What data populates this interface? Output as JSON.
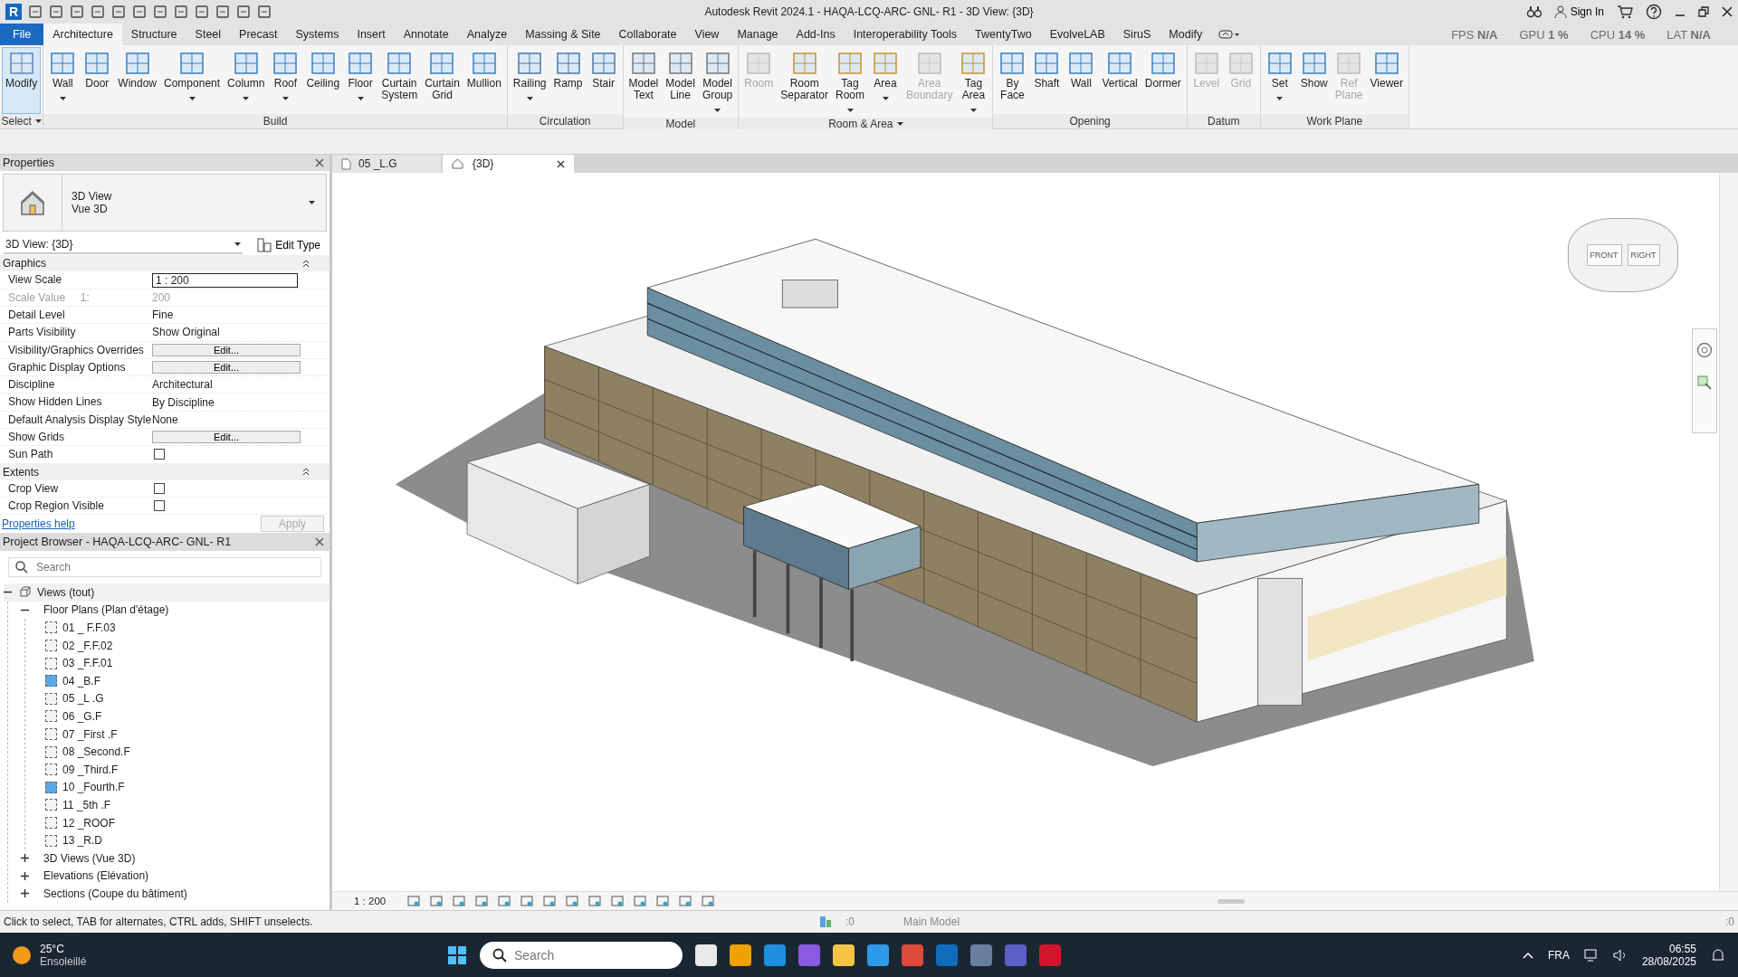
{
  "window": {
    "app_logo": "R",
    "title": "Autodesk Revit 2024.1 - HAQA-LCQ-ARC- GNL- R1 - 3D View: {3D}",
    "sign_in": "Sign In"
  },
  "perf_overlay": [
    {
      "label": "FPS",
      "value": "N/A"
    },
    {
      "label": "GPU",
      "value": "1 %"
    },
    {
      "label": "CPU",
      "value": "14 %"
    },
    {
      "label": "LAT",
      "value": "N/A"
    }
  ],
  "ribbon_tabs": [
    {
      "label": "File",
      "kind": "file",
      "selected": false
    },
    {
      "label": "Architecture",
      "kind": "tab",
      "selected": true
    },
    {
      "label": "Structure",
      "kind": "tab",
      "selected": false
    },
    {
      "label": "Steel",
      "kind": "tab",
      "selected": false
    },
    {
      "label": "Precast",
      "kind": "tab",
      "selected": false
    },
    {
      "label": "Systems",
      "kind": "tab",
      "selected": false
    },
    {
      "label": "Insert",
      "kind": "tab",
      "selected": false
    },
    {
      "label": "Annotate",
      "kind": "tab",
      "selected": false
    },
    {
      "label": "Analyze",
      "kind": "tab",
      "selected": false
    },
    {
      "label": "Massing & Site",
      "kind": "tab",
      "selected": false
    },
    {
      "label": "Collaborate",
      "kind": "tab",
      "selected": false
    },
    {
      "label": "View",
      "kind": "tab",
      "selected": false
    },
    {
      "label": "Manage",
      "kind": "tab",
      "selected": false
    },
    {
      "label": "Add-Ins",
      "kind": "tab",
      "selected": false
    },
    {
      "label": "Interoperability Tools",
      "kind": "tab",
      "selected": false
    },
    {
      "label": "TwentyTwo",
      "kind": "tab",
      "selected": false
    },
    {
      "label": "EvolveLAB",
      "kind": "tab",
      "selected": false
    },
    {
      "label": "SiruS",
      "kind": "tab",
      "selected": false
    },
    {
      "label": "Modify",
      "kind": "tab",
      "selected": false
    }
  ],
  "ribbon_panels": [
    {
      "label": "Select",
      "dropdown": true,
      "tools": [
        {
          "label": "Modify",
          "selected": true,
          "disabled": false,
          "dropdown": false
        }
      ]
    },
    {
      "label": "Build",
      "dropdown": false,
      "tools": [
        {
          "label": "Wall",
          "selected": false,
          "disabled": false,
          "dropdown": true
        },
        {
          "label": "Door",
          "selected": false,
          "disabled": false,
          "dropdown": false
        },
        {
          "label": "Window",
          "selected": false,
          "disabled": false,
          "dropdown": false
        },
        {
          "label": "Component",
          "selected": false,
          "disabled": false,
          "dropdown": true
        },
        {
          "label": "Column",
          "selected": false,
          "disabled": false,
          "dropdown": true
        },
        {
          "label": "Roof",
          "selected": false,
          "disabled": false,
          "dropdown": true
        },
        {
          "label": "Ceiling",
          "selected": false,
          "disabled": false,
          "dropdown": false
        },
        {
          "label": "Floor",
          "selected": false,
          "disabled": false,
          "dropdown": true
        },
        {
          "label": "Curtain\nSystem",
          "selected": false,
          "disabled": false,
          "dropdown": false
        },
        {
          "label": "Curtain\nGrid",
          "selected": false,
          "disabled": false,
          "dropdown": false
        },
        {
          "label": "Mullion",
          "selected": false,
          "disabled": false,
          "dropdown": false
        }
      ]
    },
    {
      "label": "Circulation",
      "dropdown": false,
      "tools": [
        {
          "label": "Railing",
          "selected": false,
          "disabled": false,
          "dropdown": true
        },
        {
          "label": "Ramp",
          "selected": false,
          "disabled": false,
          "dropdown": false
        },
        {
          "label": "Stair",
          "selected": false,
          "disabled": false,
          "dropdown": false
        }
      ]
    },
    {
      "label": "Model",
      "dropdown": false,
      "tools": [
        {
          "label": "Model\nText",
          "selected": false,
          "disabled": false,
          "dropdown": false
        },
        {
          "label": "Model\nLine",
          "selected": false,
          "disabled": false,
          "dropdown": false
        },
        {
          "label": "Model\nGroup",
          "selected": false,
          "disabled": false,
          "dropdown": true
        }
      ]
    },
    {
      "label": "Room & Area",
      "dropdown": true,
      "tools": [
        {
          "label": "Room",
          "selected": false,
          "disabled": true,
          "dropdown": false
        },
        {
          "label": "Room\nSeparator",
          "selected": false,
          "disabled": false,
          "dropdown": false
        },
        {
          "label": "Tag\nRoom",
          "selected": false,
          "disabled": false,
          "dropdown": true
        },
        {
          "label": "Area",
          "selected": false,
          "disabled": false,
          "dropdown": true
        },
        {
          "label": "Area\nBoundary",
          "selected": false,
          "disabled": true,
          "dropdown": false
        },
        {
          "label": "Tag\nArea",
          "selected": false,
          "disabled": false,
          "dropdown": true
        }
      ]
    },
    {
      "label": "Opening",
      "dropdown": false,
      "tools": [
        {
          "label": "By\nFace",
          "selected": false,
          "disabled": false,
          "dropdown": false
        },
        {
          "label": "Shaft",
          "selected": false,
          "disabled": false,
          "dropdown": false
        },
        {
          "label": "Wall",
          "selected": false,
          "disabled": false,
          "dropdown": false
        },
        {
          "label": "Vertical",
          "selected": false,
          "disabled": false,
          "dropdown": false
        },
        {
          "label": "Dormer",
          "selected": false,
          "disabled": false,
          "dropdown": false
        }
      ]
    },
    {
      "label": "Datum",
      "dropdown": false,
      "tools": [
        {
          "label": "Level",
          "selected": false,
          "disabled": true,
          "dropdown": false
        },
        {
          "label": "Grid",
          "selected": false,
          "disabled": true,
          "dropdown": false
        }
      ]
    },
    {
      "label": "Work Plane",
      "dropdown": false,
      "tools": [
        {
          "label": "Set",
          "selected": false,
          "disabled": false,
          "dropdown": true
        },
        {
          "label": "Show",
          "selected": false,
          "disabled": false,
          "dropdown": false
        },
        {
          "label": "Ref\nPlane",
          "selected": false,
          "disabled": true,
          "dropdown": false
        },
        {
          "label": "Viewer",
          "selected": false,
          "disabled": false,
          "dropdown": false
        }
      ]
    }
  ],
  "properties": {
    "title": "Properties",
    "type_name": "3D View",
    "type_subname": "Vue 3D",
    "instance": "3D View: {3D}",
    "edit_type": "Edit Type",
    "sections": [
      {
        "label": "Graphics",
        "expanded": true,
        "rows": [
          {
            "label": "View Scale",
            "value": "1 : 200",
            "kind": "input"
          },
          {
            "label": "Scale Value     1:",
            "value": "200",
            "kind": "readonly"
          },
          {
            "label": "Detail Level",
            "value": "Fine",
            "kind": "text"
          },
          {
            "label": "Parts Visibility",
            "value": "Show Original",
            "kind": "text"
          },
          {
            "label": "Visibility/Graphics Overrides",
            "value": "Edit...",
            "kind": "button"
          },
          {
            "label": "Graphic Display Options",
            "value": "Edit...",
            "kind": "button"
          },
          {
            "label": "Discipline",
            "value": "Architectural",
            "kind": "text"
          },
          {
            "label": "Show Hidden Lines",
            "value": "By Discipline",
            "kind": "text"
          },
          {
            "label": "Default Analysis Display Style",
            "value": "None",
            "kind": "text"
          },
          {
            "label": "Show Grids",
            "value": "Edit...",
            "kind": "button"
          },
          {
            "label": "Sun Path",
            "checked": false,
            "kind": "checkbox"
          }
        ]
      },
      {
        "label": "Extents",
        "expanded": true,
        "rows": [
          {
            "label": "Crop View",
            "checked": false,
            "kind": "checkbox"
          },
          {
            "label": "Crop Region Visible",
            "checked": false,
            "kind": "checkbox"
          }
        ]
      }
    ],
    "help": "Properties help",
    "apply": {
      "label": "Apply",
      "disabled": true
    }
  },
  "project_browser": {
    "title": "Project Browser - HAQA-LCQ-ARC- GNL- R1",
    "search": {
      "placeholder": "Search"
    },
    "tree": [
      {
        "label": "Views (tout)",
        "kind": "root",
        "expanded": true,
        "children": [
          {
            "label": "Floor Plans (Plan d'étage)",
            "kind": "group",
            "expanded": true,
            "children": [
              {
                "label": "01 _ F.F.03",
                "kind": "view",
                "placed": false
              },
              {
                "label": "02 _F.F.02",
                "kind": "view",
                "placed": false
              },
              {
                "label": "03 _F.F.01",
                "kind": "view",
                "placed": false
              },
              {
                "label": "04 _B.F",
                "kind": "view",
                "placed": true
              },
              {
                "label": "05 _L .G",
                "kind": "view",
                "placed": false
              },
              {
                "label": "06 _G.F",
                "kind": "view",
                "placed": false
              },
              {
                "label": "07 _First .F",
                "kind": "view",
                "placed": false
              },
              {
                "label": "08 _Second.F",
                "kind": "view",
                "placed": false
              },
              {
                "label": "09 _Third.F",
                "kind": "view",
                "placed": false
              },
              {
                "label": "10 _Fourth.F",
                "kind": "view",
                "placed": true
              },
              {
                "label": "11 _5th .F",
                "kind": "view",
                "placed": false
              },
              {
                "label": "12 _ROOF",
                "kind": "view",
                "placed": false
              },
              {
                "label": "13 _R.D",
                "kind": "view",
                "placed": false
              }
            ]
          },
          {
            "label": "3D Views (Vue 3D)",
            "kind": "group",
            "expanded": false
          },
          {
            "label": "Elevations (Elévation)",
            "kind": "group",
            "expanded": false
          },
          {
            "label": "Sections (Coupe du bâtiment)",
            "kind": "group",
            "expanded": false
          }
        ]
      }
    ]
  },
  "view_tabs": [
    {
      "label": "05 _L.G",
      "kind": "plan",
      "selected": false
    },
    {
      "label": "{3D}",
      "kind": "model",
      "selected": true
    }
  ],
  "viewcube": {
    "faces": [
      "FRONT",
      "RIGHT"
    ]
  },
  "view_control_bar": {
    "scale": "1 : 200"
  },
  "status_bar": {
    "message": "Click to select, TAB for alternates, CTRL adds, SHIFT unselects.",
    "workset_count": ":0",
    "model": "Main Model",
    "filter_count": ":0"
  },
  "taskbar": {
    "weather": {
      "temp": "25°C",
      "condition": "Ensoleillé"
    },
    "search": {
      "placeholder": "Search"
    },
    "language": "FRA",
    "time": "06:55",
    "date": "28/08/2025"
  }
}
